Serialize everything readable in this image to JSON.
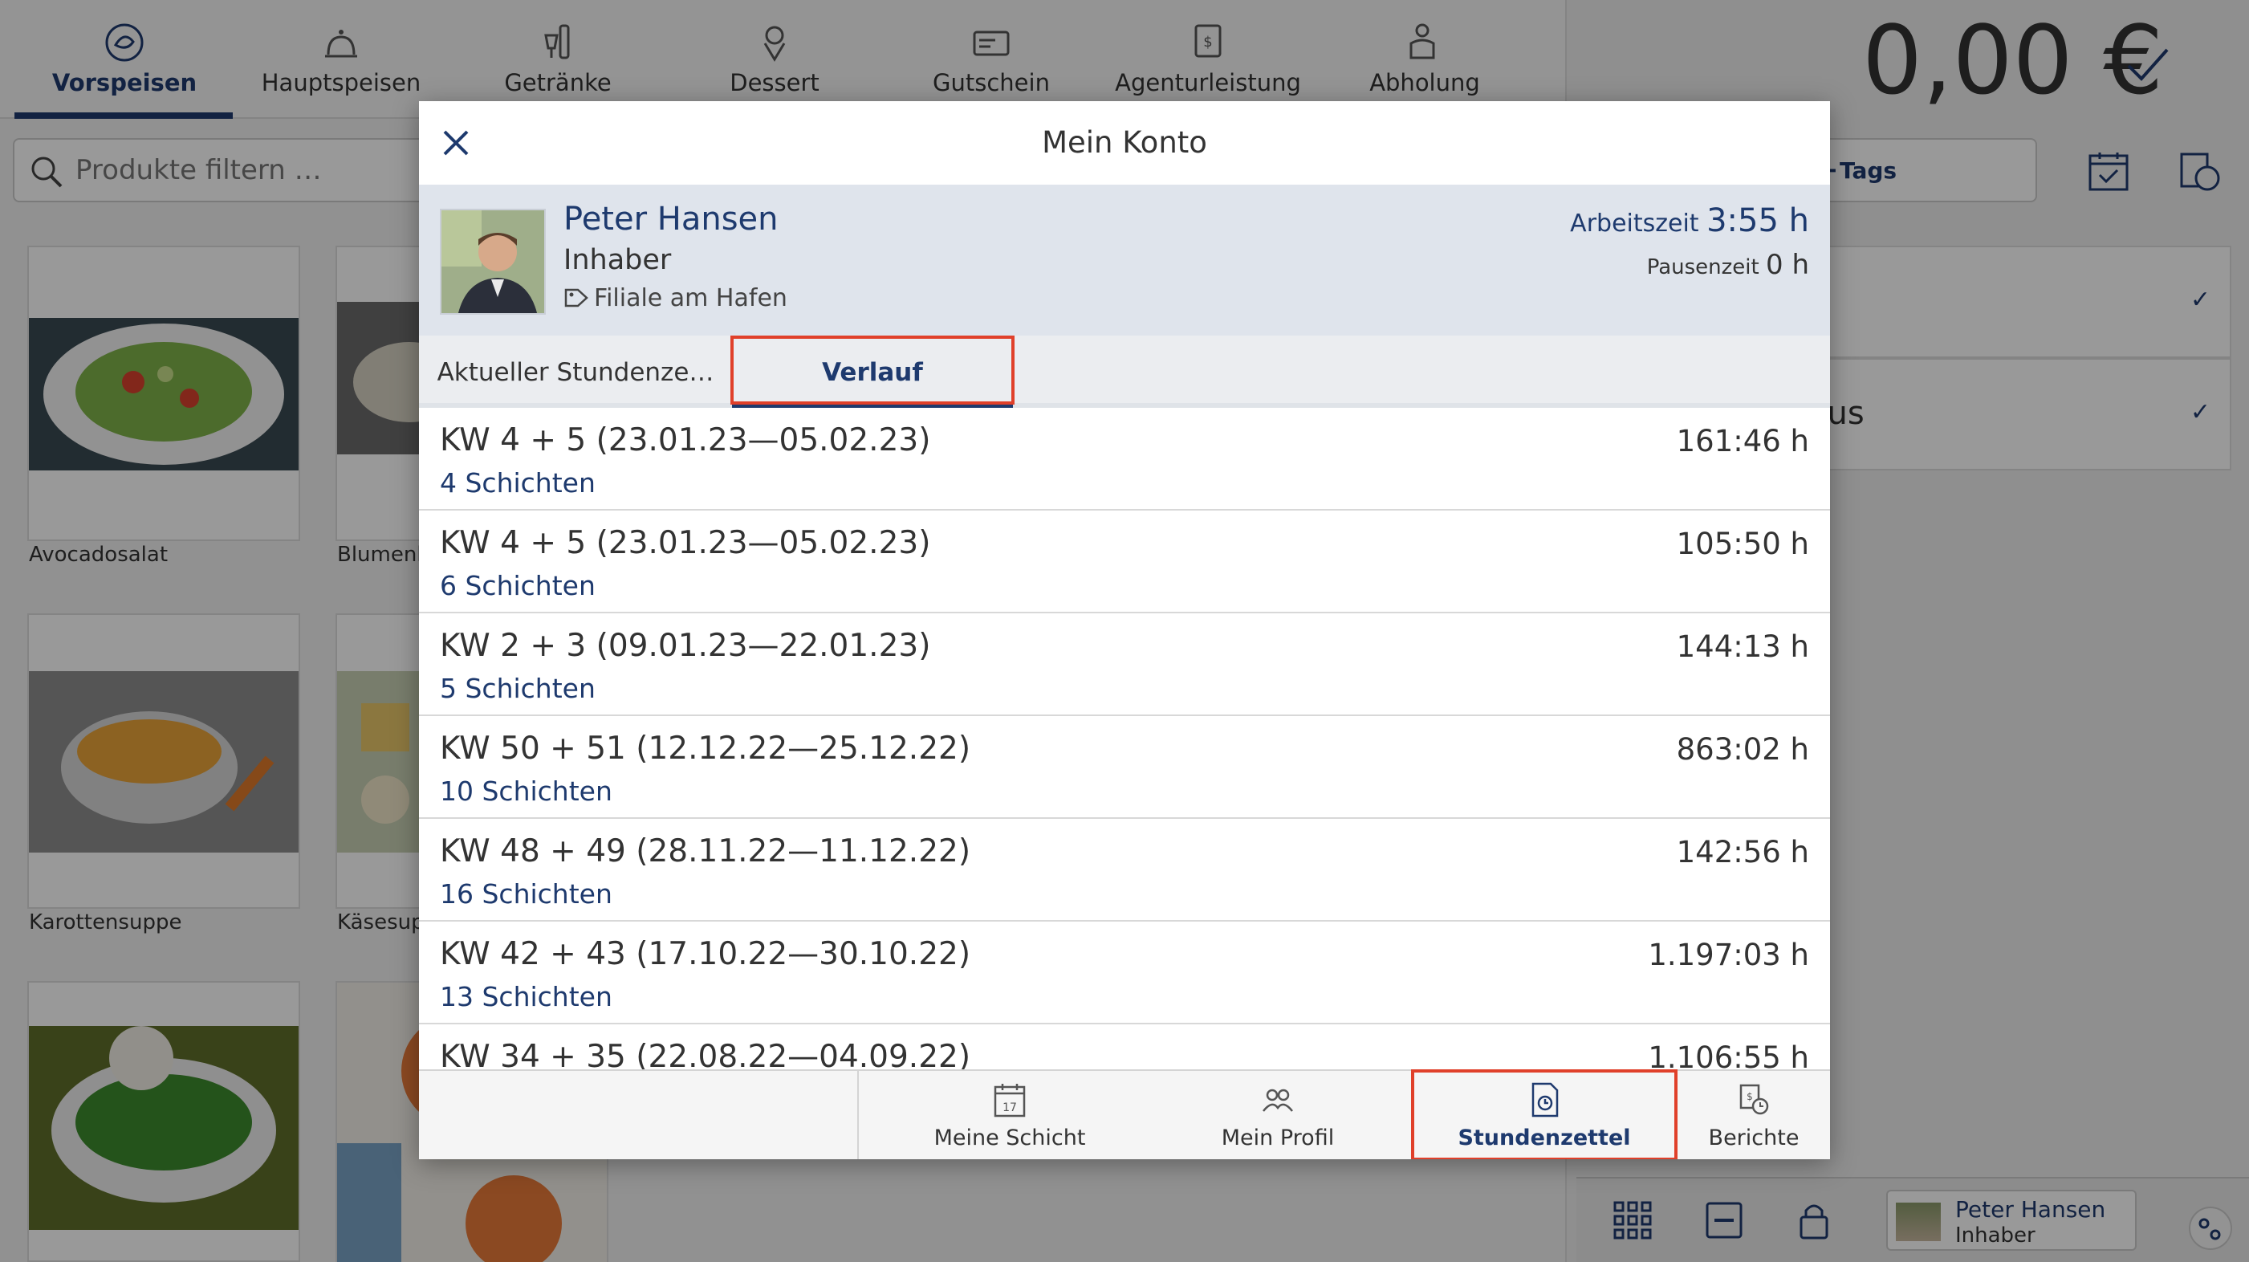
{
  "categories": [
    {
      "label": "Vorspeisen",
      "icon": "salad-icon"
    },
    {
      "label": "Hauptspeisen",
      "icon": "cloche-icon"
    },
    {
      "label": "Getränke",
      "icon": "drinks-icon"
    },
    {
      "label": "Dessert",
      "icon": "dessert-icon"
    },
    {
      "label": "Gutschein",
      "icon": "voucher-icon"
    },
    {
      "label": "Agenturleistung",
      "icon": "agency-icon"
    },
    {
      "label": "Abholung",
      "icon": "pickup-icon"
    }
  ],
  "search": {
    "placeholder": "Produkte filtern …"
  },
  "products": [
    {
      "name": "Avocadosalat",
      "colors": [
        "#7fb24a",
        "#d9412e"
      ]
    },
    {
      "name": "Blumenk",
      "colors": [
        "#6b6b6b",
        "#d8d2c4"
      ]
    },
    {
      "name": "Karottensuppe",
      "colors": [
        "#e9a33a",
        "#8e8e8e"
      ]
    },
    {
      "name": "Käsesupp",
      "colors": [
        "#e8c66a",
        "#c9d1b5"
      ]
    }
  ],
  "order_panel": {
    "total": "0,00 €",
    "tags_label": "Tags",
    "item_fragment": "aus",
    "user_name": "Peter Hansen",
    "user_role": "Inhaber"
  },
  "modal": {
    "title": "Mein Konto",
    "profile": {
      "name": "Peter Hansen",
      "role": "Inhaber",
      "branch": "Filiale am Hafen",
      "work_label": "Arbeitszeit",
      "work_value": "3:55 h",
      "pause_label": "Pausenzeit",
      "pause_value": "0 h"
    },
    "tabs": [
      {
        "label": "Aktueller Stundenze…"
      },
      {
        "label": "Verlauf"
      }
    ],
    "history": [
      {
        "title": "KW 4 + 5 (23.01.23—05.02.23)",
        "shifts": "4 Schichten",
        "hours": "161:46 h"
      },
      {
        "title": "KW 4 + 5 (23.01.23—05.02.23)",
        "shifts": "6 Schichten",
        "hours": "105:50 h"
      },
      {
        "title": "KW 2 + 3 (09.01.23—22.01.23)",
        "shifts": "5 Schichten",
        "hours": "144:13 h"
      },
      {
        "title": "KW 50 + 51 (12.12.22—25.12.22)",
        "shifts": "10 Schichten",
        "hours": "863:02 h"
      },
      {
        "title": "KW 48 + 49 (28.11.22—11.12.22)",
        "shifts": "16 Schichten",
        "hours": "142:56 h"
      },
      {
        "title": "KW 42 + 43 (17.10.22—30.10.22)",
        "shifts": "13 Schichten",
        "hours": "1.197:03 h"
      },
      {
        "title": "KW 34 + 35 (22.08.22—04.09.22)",
        "shifts": "",
        "hours": "1.106:55 h"
      }
    ],
    "footer": [
      {
        "label": "Meine Schicht",
        "icon": "calendar-icon",
        "icon_text": "17"
      },
      {
        "label": "Mein Profil",
        "icon": "people-icon"
      },
      {
        "label": "Stundenzettel",
        "icon": "timesheet-icon"
      },
      {
        "label": "Berichte",
        "icon": "reports-icon"
      }
    ]
  },
  "colors": {
    "accent": "#1e3a6e",
    "highlight": "#e0402a",
    "profile_bg": "#dfe4ec"
  }
}
